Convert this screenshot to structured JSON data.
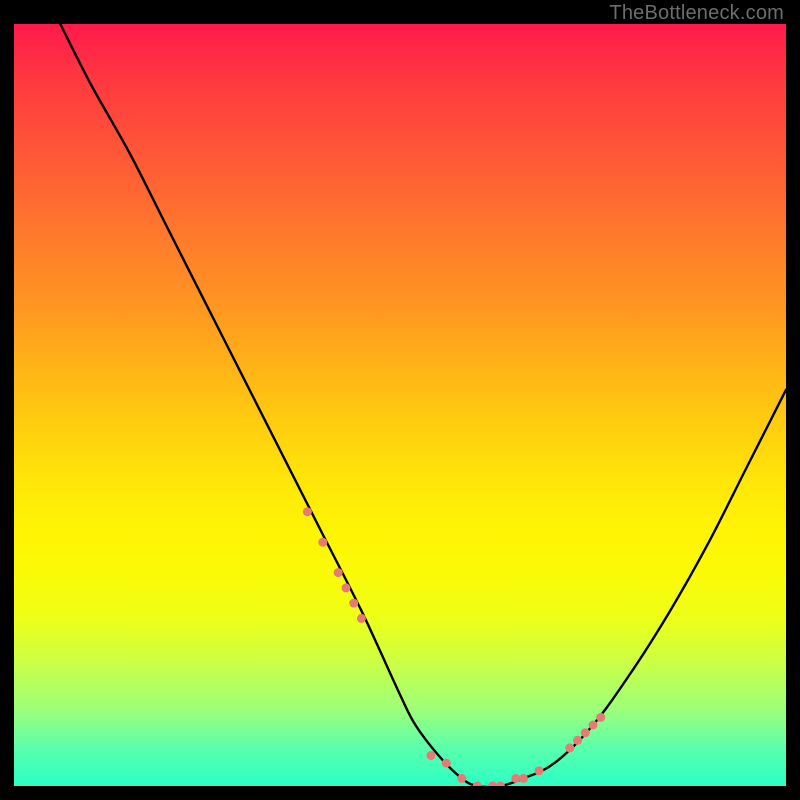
{
  "watermark": "TheBottleneck.com",
  "chart_data": {
    "type": "line",
    "title": "",
    "xlabel": "",
    "ylabel": "",
    "xlim": [
      0,
      100
    ],
    "ylim": [
      0,
      100
    ],
    "series": [
      {
        "name": "bottleneck-curve",
        "x": [
          6,
          10,
          15,
          20,
          25,
          30,
          35,
          40,
          45,
          50,
          52,
          55,
          58,
          60,
          63,
          66,
          70,
          75,
          80,
          85,
          90,
          95,
          100
        ],
        "y": [
          100,
          92,
          83,
          73,
          63,
          53,
          43,
          33,
          23,
          12,
          8,
          4,
          1,
          0,
          0,
          1,
          3,
          8,
          15,
          23,
          32,
          42,
          52
        ]
      }
    ],
    "markers": {
      "name": "highlight-dots",
      "x": [
        38,
        40,
        42,
        43,
        44,
        45,
        54,
        56,
        58,
        60,
        62,
        63,
        65,
        66,
        68,
        72,
        73,
        74,
        75,
        76
      ],
      "y": [
        36,
        32,
        28,
        26,
        24,
        22,
        4,
        3,
        1,
        0,
        0,
        0,
        1,
        1,
        2,
        5,
        6,
        7,
        8,
        9
      ],
      "color": "#e77a74",
      "size": 9
    }
  }
}
